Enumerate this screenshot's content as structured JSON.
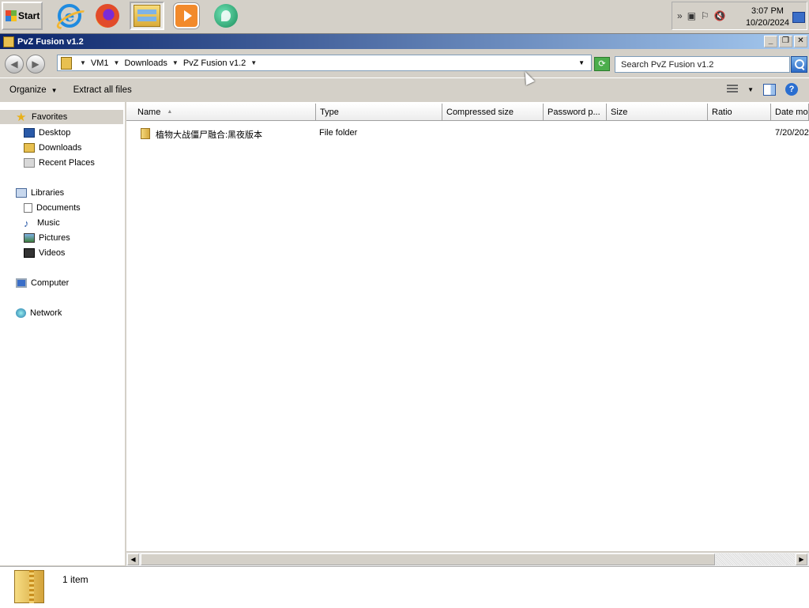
{
  "taskbar": {
    "start_label": "Start",
    "apps": [
      "internet-explorer",
      "firefox",
      "windows-explorer",
      "media-player",
      "green-app"
    ],
    "clock": {
      "time": "3:07 PM",
      "date": "10/20/2024"
    }
  },
  "window": {
    "title": "PvZ Fusion v1.2",
    "minimize": "_",
    "maximize": "❐",
    "close": "✕"
  },
  "address": {
    "crumbs": [
      "VM1",
      "Downloads",
      "PvZ Fusion v1.2"
    ],
    "search_placeholder": "Search PvZ Fusion v1.2"
  },
  "commands": {
    "organize": "Organize",
    "extract": "Extract all files"
  },
  "nav": {
    "favorites": "Favorites",
    "desktop": "Desktop",
    "downloads": "Downloads",
    "recent": "Recent Places",
    "libraries": "Libraries",
    "documents": "Documents",
    "music": "Music",
    "pictures": "Pictures",
    "videos": "Videos",
    "computer": "Computer",
    "network": "Network"
  },
  "columns": [
    "Name",
    "Type",
    "Compressed size",
    "Password p...",
    "Size",
    "Ratio",
    "Date mod"
  ],
  "files": [
    {
      "name": "植物大战僵尸融合:黑夜版本",
      "type": "File folder",
      "date": "7/20/202"
    }
  ],
  "status": {
    "count": "1 item"
  }
}
